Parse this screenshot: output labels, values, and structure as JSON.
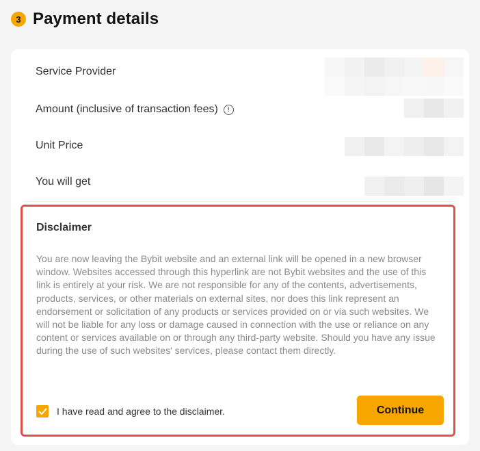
{
  "section": {
    "step_number": "3",
    "title": "Payment details"
  },
  "details": {
    "service_provider": "Service Provider",
    "amount": "Amount (inclusive of transaction fees)",
    "amount_info_glyph": "!",
    "unit_price": "Unit Price",
    "you_will_get": "You will get"
  },
  "disclaimer": {
    "title": "Disclaimer",
    "body": "You are now leaving the Bybit website and an external link will be opened in a new browser window. Websites accessed through this hyperlink are not Bybit websites and the use of this link is entirely at your risk. We are not responsible for any of the contents, advertisements, products, services, or other materials on external sites, nor does this link represent an endorsement or solicitation of any products or services provided on or via such websites. We will not be liable for any loss or damage caused in connection with the use or reliance on any content or services available on or through any third-party website. Should you have any issue during the use of such websites' services, please contact them directly.",
    "agree_label": "I have read and agree to the disclaimer.",
    "agree_checked": true,
    "continue_label": "Continue"
  },
  "colors": {
    "accent": "#f7a600",
    "highlight_border": "#e2504a",
    "card_background": "#ffffff",
    "page_background": "#f5f5f5"
  },
  "icons": {
    "info": "info-circle-icon",
    "check": "checkmark-icon"
  }
}
